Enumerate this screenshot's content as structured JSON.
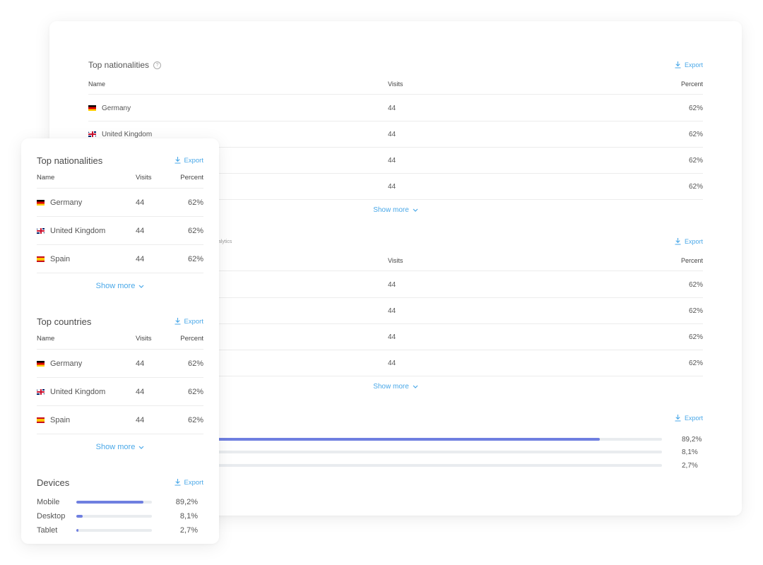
{
  "colors": {
    "accent": "#4aa8e8",
    "bar_fill": "#6f7fe0",
    "bar_track": "#e9ecef"
  },
  "back": {
    "nationalities": {
      "title": "Top nationalities",
      "help_icon": "?",
      "export_label": "Export",
      "columns": {
        "name": "Name",
        "visits": "Visits",
        "percent": "Percent"
      },
      "rows": [
        {
          "flag": "de",
          "name": "Germany",
          "visits": "44",
          "percent": "62%"
        },
        {
          "flag": "gb",
          "name": "United Kingdom",
          "visits": "44",
          "percent": "62%"
        },
        {
          "flag": "",
          "name": "",
          "visits": "44",
          "percent": "62%"
        },
        {
          "flag": "",
          "name": "",
          "visits": "44",
          "percent": "62%"
        }
      ],
      "show_more": "Show more"
    },
    "countries": {
      "title_fragment": "nalytics",
      "export_label": "Export",
      "columns": {
        "visits": "Visits",
        "percent": "Percent"
      },
      "rows": [
        {
          "visits": "44",
          "percent": "62%"
        },
        {
          "visits": "44",
          "percent": "62%"
        },
        {
          "visits": "44",
          "percent": "62%"
        },
        {
          "visits": "44",
          "percent": "62%"
        }
      ],
      "show_more": "Show more"
    },
    "devices": {
      "export_label": "Export",
      "items": [
        {
          "value": 89.2,
          "label": "89,2%"
        },
        {
          "value": 8.1,
          "label": "8,1%"
        },
        {
          "value": 2.7,
          "label": "2,7%"
        }
      ]
    }
  },
  "front": {
    "nationalities": {
      "title": "Top nationalities",
      "export_label": "Export",
      "columns": {
        "name": "Name",
        "visits": "Visits",
        "percent": "Percent"
      },
      "rows": [
        {
          "flag": "de",
          "name": "Germany",
          "visits": "44",
          "percent": "62%"
        },
        {
          "flag": "gb",
          "name": "United Kingdom",
          "visits": "44",
          "percent": "62%"
        },
        {
          "flag": "es",
          "name": "Spain",
          "visits": "44",
          "percent": "62%"
        }
      ],
      "show_more": "Show more"
    },
    "countries": {
      "title": "Top countries",
      "export_label": "Export",
      "columns": {
        "name": "Name",
        "visits": "Visits",
        "percent": "Percent"
      },
      "rows": [
        {
          "flag": "de",
          "name": "Germany",
          "visits": "44",
          "percent": "62%"
        },
        {
          "flag": "gb",
          "name": "United Kingdom",
          "visits": "44",
          "percent": "62%"
        },
        {
          "flag": "es",
          "name": "Spain",
          "visits": "44",
          "percent": "62%"
        }
      ],
      "show_more": "Show more"
    },
    "devices": {
      "title": "Devices",
      "export_label": "Export",
      "items": [
        {
          "name": "Mobile",
          "value": 89.2,
          "label": "89,2%"
        },
        {
          "name": "Desktop",
          "value": 8.1,
          "label": "8,1%"
        },
        {
          "name": "Tablet",
          "value": 2.7,
          "label": "2,7%"
        }
      ]
    }
  }
}
